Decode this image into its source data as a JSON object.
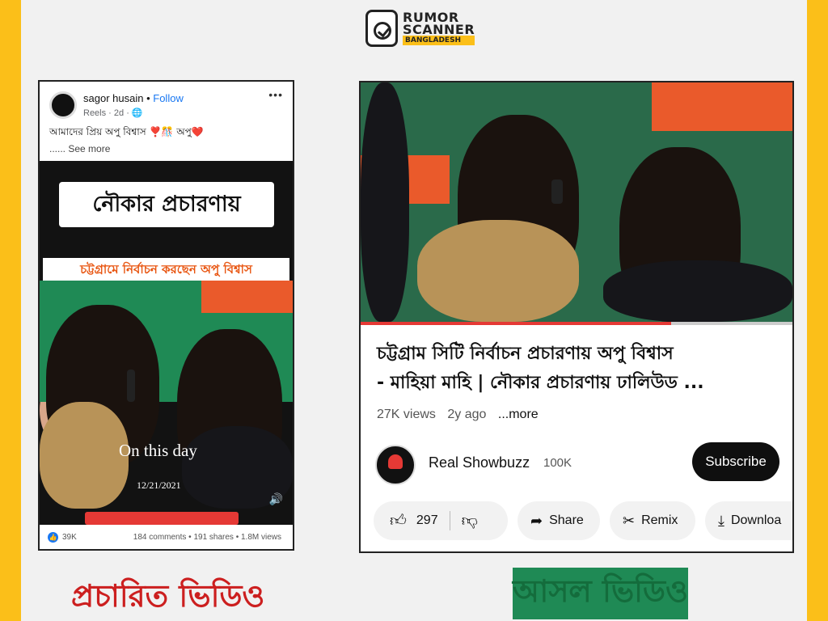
{
  "brand": {
    "line1": "RUMOR",
    "line2": "SCANNER",
    "line3": "BANGLADESH",
    "accent_color": "#fbbf19"
  },
  "facebook_post": {
    "author": "sagor husain",
    "separator": "•",
    "follow_label": "Follow",
    "meta": "Reels · 2d · 🌐",
    "caption": "আমাদের প্রিয় অপু বিশ্বাস ❣️🎊 অপু❤️",
    "see_more": "...... See more",
    "overlay_box": "নৌকার প্রচারণায়",
    "overlay_band": "চট্টগ্রামে নির্বাচন করছেন অপু বিশ্বাস",
    "on_this_day": "On this day",
    "date": "12/21/2021",
    "likes": "39K",
    "stats": "184 comments • 191 shares • 1.8M views",
    "icons": [
      "more-dots-icon",
      "globe-icon",
      "volume-icon",
      "like-icon"
    ]
  },
  "youtube_video": {
    "title_line1": "চট্টগ্রাম সিটি নির্বাচন প্রচারণায় অপু বিশ্বাস",
    "title_line2": "- মাহিয়া মাহি | নৌকার প্রচারণায় ঢালিউড ...",
    "views": "27K views",
    "age": "2y ago",
    "more": "...more",
    "channel_name": "Real Showbuzz",
    "subscribers": "100K",
    "subscribe_label": "Subscribe",
    "like_count": "297",
    "share_label": "Share",
    "remix_label": "Remix",
    "download_label": "Downloa",
    "progress_fraction": 0.72,
    "icons": [
      "thumbs-up-icon",
      "thumbs-down-icon",
      "share-icon",
      "remix-icon",
      "download-icon"
    ]
  },
  "captions": {
    "left": "প্রচারিত ভিডিও",
    "right": "আসল ভিডিও"
  },
  "colors": {
    "left_caption": "#cc1f1f",
    "right_caption": "#146c3c",
    "youtube_red": "#e53935",
    "facebook_blue": "#1877f2"
  }
}
